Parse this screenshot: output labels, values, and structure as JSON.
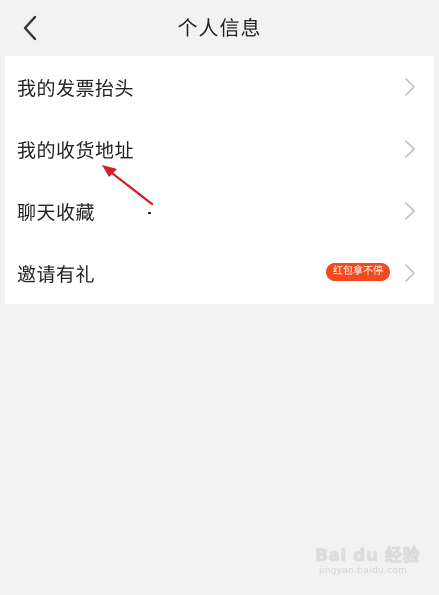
{
  "header": {
    "title": "个人信息",
    "back_icon": "chevron-left-icon"
  },
  "menu": {
    "items": [
      {
        "label": "我的发票抬头"
      },
      {
        "label": "我的收货地址"
      },
      {
        "label": "聊天收藏"
      },
      {
        "label": "邀请有礼",
        "badge": "红包拿不停"
      }
    ]
  },
  "colors": {
    "badge_bg": "#f04a1e",
    "annotation_arrow": "#d21f1f",
    "list_bg": "#ffffff",
    "page_bg": "#f2f2f2"
  },
  "watermark": {
    "brand": "Bai du 经验",
    "url": "jingyan.baidu.com"
  }
}
